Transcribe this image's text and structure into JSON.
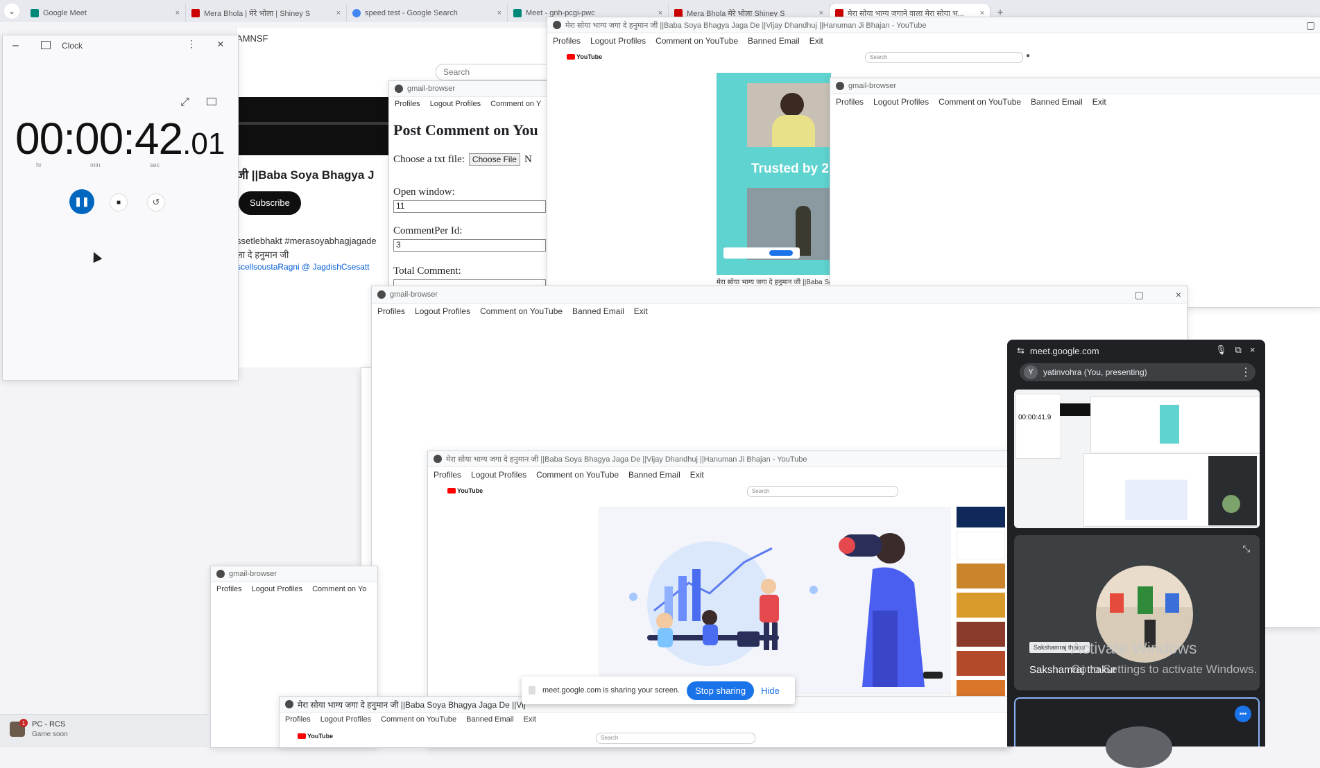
{
  "browser": {
    "tabs": [
      {
        "label": "Google Meet",
        "favicon": "meet-icon"
      },
      {
        "label": "Mera Bhola | मेरे भोला | Shiney S",
        "favicon": "youtube-icon"
      },
      {
        "label": "speed test - Google Search",
        "favicon": "google-icon"
      },
      {
        "label": "Meet - gnh-pcgi-pwc",
        "favicon": "meet-icon"
      },
      {
        "label": "Mera Bhola मेरे भोला Shiney S",
        "favicon": "youtube-icon"
      },
      {
        "label": "मेरा सोया भाग्य जगाने वाला मेरा सोया भ...",
        "favicon": "youtube-icon"
      }
    ],
    "new_tab": "+"
  },
  "clock": {
    "title": "Clock",
    "time_main": "00:00:42",
    "time_fraction": ".01",
    "labels": [
      "hr",
      "min",
      "sec"
    ],
    "expand_icon": "expand-icon",
    "overlay_icon": "keep-on-top-icon"
  },
  "youtube_bg": {
    "partial_header": "AMNSF",
    "search_placeholder": "Search",
    "video_title": "जी ||Baba Soya Bhagya J",
    "subscribe": "Subscribe",
    "desc1": "ssetlebhakt #merasoyabhagjagade",
    "desc2": "ला दे हनुमान जी",
    "desc3": "scellsoustaRagni @ JagdishCsesatt"
  },
  "gmail_window_1": {
    "title": "gmail-browser",
    "menu": [
      "Profiles",
      "Logout Profiles",
      "Comment on Y"
    ],
    "heading": "Post Comment on You",
    "choose_label": "Choose a txt file:",
    "choose_button": "Choose File",
    "choose_trailing": "N",
    "open_window_label": "Open window:",
    "open_window_value": "11",
    "comment_per_id_label": "CommentPer Id:",
    "comment_per_id_value": "3",
    "total_comment_label": "Total Comment:"
  },
  "youtube_main": {
    "title": "मेरा सोया भाग्य जगा दे हनुमान जी ||Baba Soya Bhagya Jaga De ||Vijay Dhandhuj ||Hanuman Ji Bhajan - YouTube",
    "menu": [
      "Profiles",
      "Logout Profiles",
      "Comment on YouTube",
      "Banned Email",
      "Exit"
    ],
    "logo": "YouTube",
    "search": "Search",
    "thumb_text": "Trusted by 2",
    "video_caption": "मेरा सोया भाग्य जगा दे हनुमान जी ||Baba Soya Bh"
  },
  "gmail_window_2": {
    "title": "gmail-browser",
    "menu": [
      "Profiles",
      "Logout Profiles",
      "Comment on YouTube",
      "Banned Email",
      "Exit"
    ]
  },
  "gmail_window_3": {
    "title": "gmail-browser",
    "menu": [
      "Profiles",
      "Logout Profiles",
      "Comment on YouTube",
      "Banned Email",
      "Exit"
    ]
  },
  "youtube_inner": {
    "title": "मेरा सोया भाग्य जगा दे हनुमान जी ||Baba Soya Bhagya Jaga De ||Vijay Dhandhuj ||Hanuman Ji Bhajan - YouTube",
    "menu": [
      "Profiles",
      "Logout Profiles",
      "Comment on YouTube",
      "Banned Email",
      "Exit"
    ],
    "logo": "YouTube",
    "search": "Search"
  },
  "gmail_window_4": {
    "title": "gmail-browser",
    "menu": [
      "Profiles",
      "Logout Profiles",
      "Comment on Yo"
    ]
  },
  "youtube_bottom": {
    "title": "मेरा सोया भाग्य जगा दे हनुमान जी ||Baba Soya Bhagya Jaga De ||Vij",
    "menu": [
      "Profiles",
      "Logout Profiles",
      "Comment on YouTube",
      "Banned Email",
      "Exit"
    ],
    "logo": "YouTube",
    "search": "Search"
  },
  "share_bar": {
    "text": "meet.google.com is sharing your screen.",
    "stop": "Stop sharing",
    "hide": "Hide"
  },
  "meet_panel": {
    "url": "meet.google.com",
    "presenter": "yatinvohra (You, presenting)",
    "presenter_initial": "Y",
    "participant_name": "Sakshamraj thakur",
    "participant_tag": "Sakshamraj thakur",
    "preview_time": "00:00:41.9"
  },
  "watermark": {
    "line1": "Activate Windows",
    "line2": "Go to Settings to activate Windows."
  },
  "taskbar": {
    "app_name": "PC - RCS",
    "app_subtitle": "Game soon",
    "badge": "1"
  },
  "colors": {
    "accent_blue": "#1a73e8",
    "pause_blue": "#0067c0",
    "meet_dark": "#202124",
    "teal_thumb": "#5fd3cf",
    "youtube_red": "#ff0000"
  }
}
